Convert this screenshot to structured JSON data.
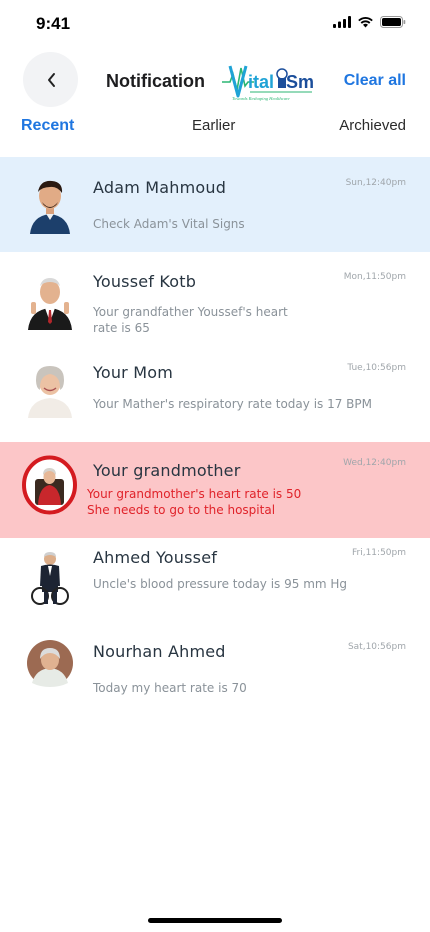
{
  "status": {
    "time": "9:41"
  },
  "header": {
    "title": "Notification",
    "clear_all": "Clear all",
    "logo_text": "VitalSm",
    "logo_tagline": "Towards Reshaping Healthcare"
  },
  "tabs": [
    {
      "label": "Recent",
      "active": true
    },
    {
      "label": "Earlier",
      "active": false
    },
    {
      "label": "Archieved",
      "active": false
    }
  ],
  "notifications": [
    {
      "name": "Adam Mahmoud",
      "time": "Sun,12:40pm",
      "message": "Check Adam's Vital Signs",
      "highlight": "blue"
    },
    {
      "name": "Youssef Kotb",
      "time": "Mon,11:50pm",
      "message": "Your grandfather Youssef's heart rate is 65",
      "highlight": "none"
    },
    {
      "name": "Your Mom",
      "time": "Tue,10:56pm",
      "message": "Your Mather's respiratory rate today is 17 BPM",
      "highlight": "none"
    },
    {
      "name": "Your grandmother",
      "time": "Wed,12:40pm",
      "message": "Your grandmother's heart rate is 50",
      "message2": "She needs to go to the hospital",
      "highlight": "red"
    },
    {
      "name": "Ahmed Youssef",
      "time": "Fri,11:50pm",
      "message": "Uncle's blood pressure today is 95 mm Hg",
      "highlight": "none"
    },
    {
      "name": "Nourhan Ahmed",
      "time": "Sat,10:56pm",
      "message": "Today my heart rate is 70",
      "highlight": "none"
    }
  ],
  "colors": {
    "accent": "#1f76e0",
    "highlight_blue": "#e3f0fc",
    "highlight_red": "#fcc6c8",
    "alert_text": "#e0232a"
  }
}
